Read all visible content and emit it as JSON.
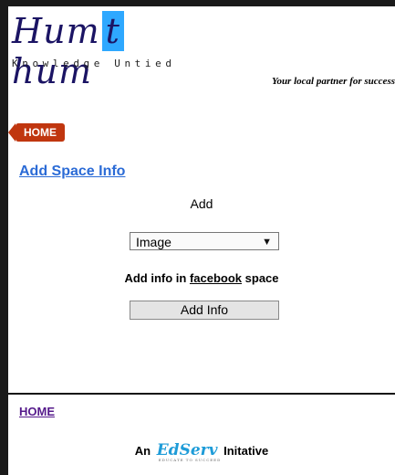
{
  "header": {
    "logo_word_a": "Hum",
    "logo_word_hl": "t",
    "logo_word_b": "hum",
    "logo_subtitle": "Knowledge Untied",
    "tagline": "Your local partner for success"
  },
  "nav": {
    "home_label": "HOME"
  },
  "main": {
    "title": "Add Space Info",
    "add_label": "Add",
    "select_value": "Image",
    "info_prefix": "Add info in",
    "info_space": "facebook",
    "info_suffix": "space",
    "submit_label": "Add Info"
  },
  "footer": {
    "home_label": "HOME",
    "initiative_prefix": "An",
    "brand": "EdServ",
    "brand_tagline": "EDUCATE TO SUCCEED",
    "initiative_suffix": "Initative"
  },
  "colors": {
    "home_button": "#c0360f",
    "link": "#2b6bd6",
    "visited_link": "#551a8b",
    "logo_highlight": "#2ea8ff"
  }
}
